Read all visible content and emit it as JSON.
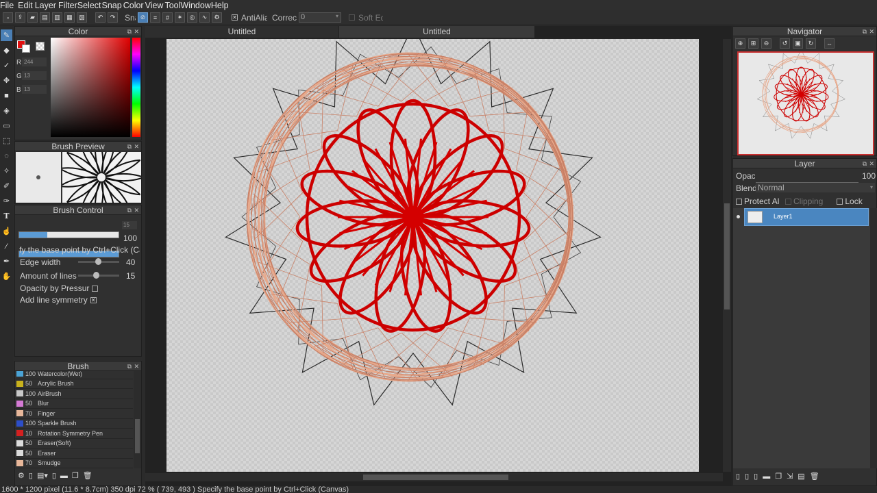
{
  "menu": [
    "File",
    "Edit",
    "Layer",
    "Filter",
    "Select",
    "Snap",
    "Color",
    "View",
    "Tool",
    "Window",
    "Help"
  ],
  "toolbar": {
    "snap_label": "Snap",
    "antialias_label": "AntiAlias",
    "correction_label": "Correc",
    "correction_value": "0",
    "soft_edge_label": "Soft Ed"
  },
  "tabs": {
    "left": "Untitled",
    "right": "Untitled"
  },
  "color_panel": {
    "title": "Color",
    "r_label": "R",
    "g_label": "G",
    "b_label": "B",
    "r": "244",
    "g": "13",
    "b": "13",
    "fg": "#e01010",
    "bg": "#ffffff"
  },
  "brush_preview": {
    "title": "Brush Preview"
  },
  "brush_control": {
    "title": "Brush Control",
    "size_value": "15",
    "opacity_value": "100",
    "hint": "fy the base point by Ctrl+Click (Ca",
    "edge_width_label": "Edge width",
    "edge_width_value": "40",
    "edge_width_level": 0.4,
    "lines_label": "Amount of lines",
    "lines_value": "15",
    "opacity_pressure_label": "Opacity by Pressur",
    "line_symmetry_label": "Add line symmetry"
  },
  "brush_panel": {
    "title": "Brush",
    "items": [
      {
        "size": "100",
        "name": "Watercolor(Wet)",
        "color": "#4aa3d6"
      },
      {
        "size": "50",
        "name": "Acrylic Brush",
        "color": "#c9b21d"
      },
      {
        "size": "100",
        "name": "AirBrush",
        "color": "#c9c9c9"
      },
      {
        "size": "50",
        "name": "Blur",
        "color": "#d47ad4"
      },
      {
        "size": "70",
        "name": "Finger",
        "color": "#e8b79a"
      },
      {
        "size": "100",
        "name": "Sparkle Brush",
        "color": "#2c4ec9"
      },
      {
        "size": "10",
        "name": "Rotation Symmetry Pen",
        "color": "#d42020"
      },
      {
        "size": "50",
        "name": "Eraser(Soft)",
        "color": "#dcdcdc"
      },
      {
        "size": "50",
        "name": "Eraser",
        "color": "#dcdcdc"
      },
      {
        "size": "70",
        "name": "Smudge",
        "color": "#e8b79a"
      }
    ]
  },
  "navigator": {
    "title": "Navigator"
  },
  "layer_panel": {
    "title": "Layer",
    "opacity_label": "Opac",
    "opacity_value": "100",
    "blend_label": "Blend",
    "blend_value": "Normal",
    "protect_alpha_label": "Protect Al",
    "clipping_label": "Clipping",
    "lock_label": "Lock",
    "layer_name": "Layer1"
  },
  "status": "1600 * 1200 pixel   (11.6 * 8.7cm)   350 dpi   72 %   ( 739, 493 )   Specify the base point by Ctrl+Click (Canvas)"
}
